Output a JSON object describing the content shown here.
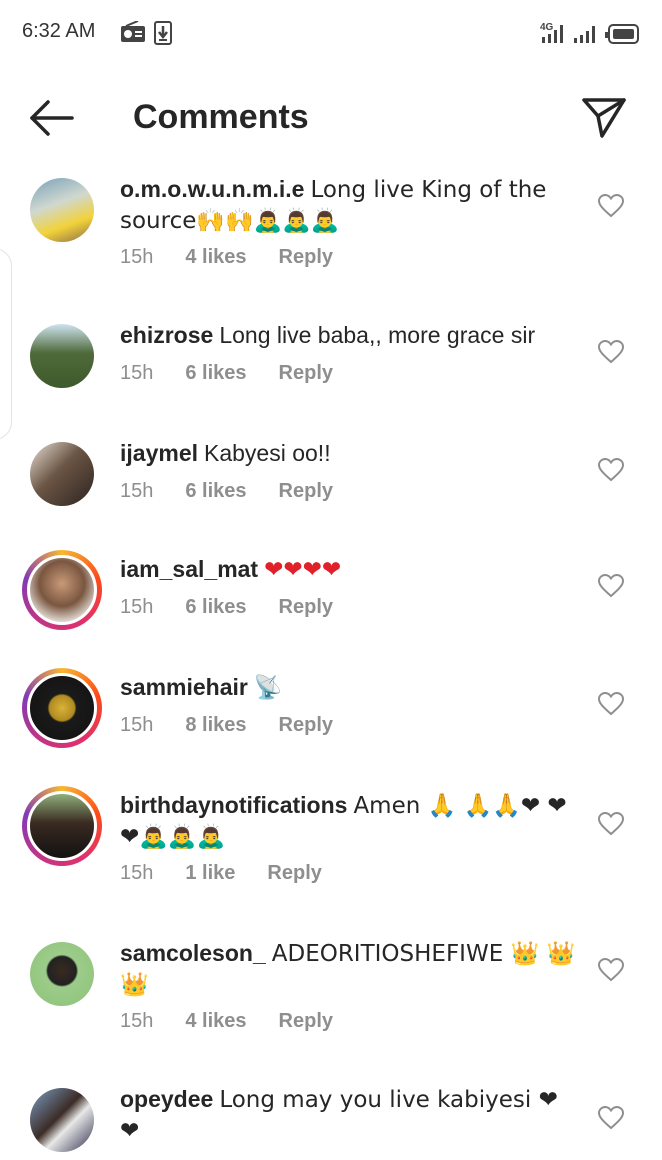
{
  "status": {
    "time": "6:32 AM",
    "network": "4G"
  },
  "header": {
    "title": "Comments"
  },
  "comments": [
    {
      "user": "o.m.o.w.u.n.m.i.e",
      "text": "Long live King of the source🙌🙌🙇‍♂️🙇‍♂️🙇‍♂️",
      "time": "15h",
      "likes": "4 likes",
      "reply": "Reply"
    },
    {
      "user": "ehizrose",
      "text": "Long live baba,, more grace sir",
      "time": "15h",
      "likes": "6 likes",
      "reply": "Reply"
    },
    {
      "user": "ijaymel",
      "text": "Kabyesi oo!!",
      "time": "15h",
      "likes": "6 likes",
      "reply": "Reply"
    },
    {
      "user": "iam_sal_mat",
      "text": "❤❤❤❤",
      "time": "15h",
      "likes": "6 likes",
      "reply": "Reply"
    },
    {
      "user": "sammiehair",
      "text": "📡",
      "time": "15h",
      "likes": "8 likes",
      "reply": "Reply"
    },
    {
      "user": "birthdaynotifications",
      "text": "Amen 🙏 🙏🙏❤ ❤❤🙇‍♂️🙇‍♂️🙇‍♂️",
      "time": "15h",
      "likes": "1 like",
      "reply": "Reply"
    },
    {
      "user": "samcoleson_",
      "text": "ADEORITIOSHEFIWE 👑 👑👑",
      "time": "15h",
      "likes": "4 likes",
      "reply": "Reply"
    },
    {
      "user": "opeydee",
      "text": "Long may you live kabiyesi ❤ ❤",
      "time": "",
      "likes": "",
      "reply": ""
    }
  ],
  "icons": {
    "back": "arrow-left-icon",
    "send": "paper-plane-icon",
    "like": "heart-outline-icon"
  },
  "colors": {
    "story_ring": "#e1306c",
    "heart_red": "#e0202a",
    "meta_gray": "#8e8e8e"
  }
}
